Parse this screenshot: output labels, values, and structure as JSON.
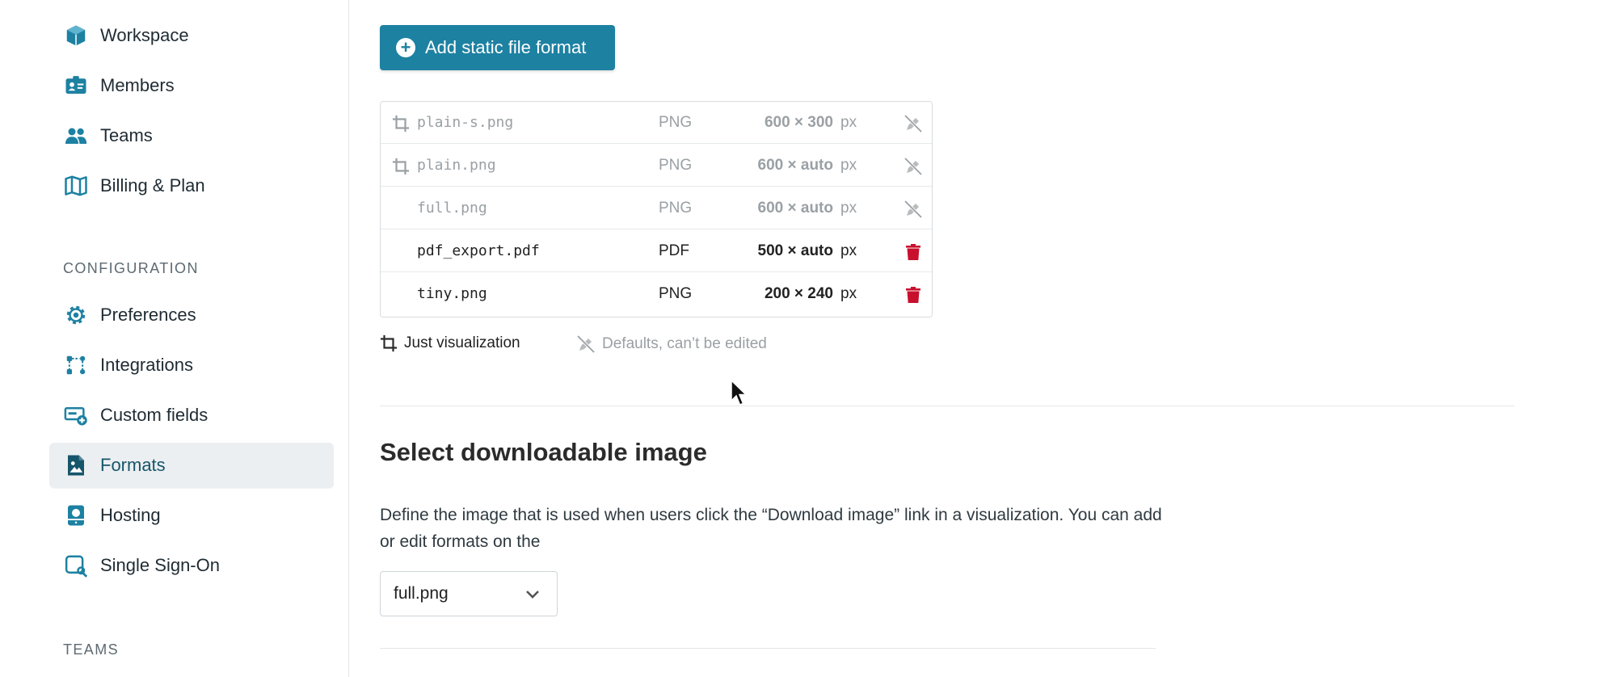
{
  "sidebar": {
    "items": [
      {
        "label": "Workspace",
        "icon": "workspace-cube-icon"
      },
      {
        "label": "Members",
        "icon": "id-card-icon"
      },
      {
        "label": "Teams",
        "icon": "people-icon"
      },
      {
        "label": "Billing & Plan",
        "icon": "map-icon"
      }
    ],
    "config_label": "CONFIGURATION",
    "config_items": [
      {
        "label": "Preferences",
        "icon": "gear-icon"
      },
      {
        "label": "Integrations",
        "icon": "integrations-icon"
      },
      {
        "label": "Custom fields",
        "icon": "custom-fields-icon"
      },
      {
        "label": "Formats",
        "icon": "image-file-icon",
        "active": true
      },
      {
        "label": "Hosting",
        "icon": "server-icon"
      },
      {
        "label": "Single Sign-On",
        "icon": "sso-icon"
      }
    ],
    "teams_label": "TEAMS"
  },
  "main": {
    "add_button_label": "Add static file format",
    "formats": [
      {
        "name": "plain-s.png",
        "type": "PNG",
        "size": "600 × 300",
        "unit": "px",
        "visualization_only": true,
        "default": true
      },
      {
        "name": "plain.png",
        "type": "PNG",
        "size": "600 × auto",
        "unit": "px",
        "visualization_only": true,
        "default": true
      },
      {
        "name": "full.png",
        "type": "PNG",
        "size": "600 × auto",
        "unit": "px",
        "visualization_only": false,
        "default": true
      },
      {
        "name": "pdf_export.pdf",
        "type": "PDF",
        "size": "500 × auto",
        "unit": "px",
        "visualization_only": false,
        "default": false
      },
      {
        "name": "tiny.png",
        "type": "PNG",
        "size": "200 × 240",
        "unit": "px",
        "visualization_only": false,
        "default": false
      }
    ],
    "legend_visualization": "Just visualization",
    "legend_defaults": "Defaults, can’t be edited",
    "section_title": "Select downloadable image",
    "section_description": "Define the image that is used when users click the “Download image” link in a visualization. You can add or edit formats on the",
    "select_value": "full.png"
  },
  "colors": {
    "accent": "#1d81a2",
    "icon": "#1d81a2",
    "delete": "#c8102e",
    "muted": "#9aa0a4"
  }
}
